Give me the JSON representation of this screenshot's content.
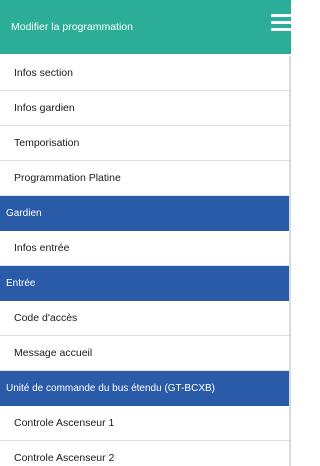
{
  "header": {
    "title": "Modifier la programmation",
    "menu_icon": "hamburger-menu-icon"
  },
  "colors": {
    "header": "#2cad97",
    "section": "#2a5ba8"
  },
  "items": {
    "infos_section": "Infos section",
    "infos_gardien": "Infos gardien",
    "temporisation": "Temporisation",
    "programmation_platine": "Programmation Platine",
    "section_gardien": "Gardien",
    "infos_entree": "Infos entrée",
    "section_entree": "Entrée",
    "code_acces": "Code d'accès",
    "message_accueil": "Message accueil",
    "section_unite": "Unité de commande du bus étendu (GT-BCXB)",
    "controle_ascenseur_1": "Controle Ascenseur 1",
    "controle_ascenseur_2": "Controle Ascenseur 2"
  }
}
